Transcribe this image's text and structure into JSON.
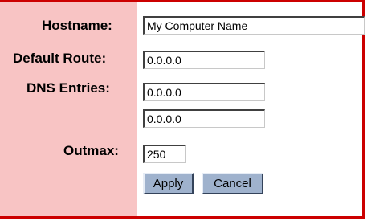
{
  "form": {
    "hostname_label": "Hostname:",
    "hostname_value": "My Computer Name",
    "default_route_label": "Default Route:",
    "default_route_value": "0.0.0.0",
    "dns_label": "DNS Entries:",
    "dns_values": [
      "0.0.0.0",
      "0.0.0.0"
    ],
    "outmax_label": "Outmax:",
    "outmax_value": "250",
    "apply_label": "Apply",
    "cancel_label": "Cancel"
  },
  "colors": {
    "border": "#cc0000",
    "label_panel": "#f8c4c4",
    "button": "#9fb2cd"
  }
}
